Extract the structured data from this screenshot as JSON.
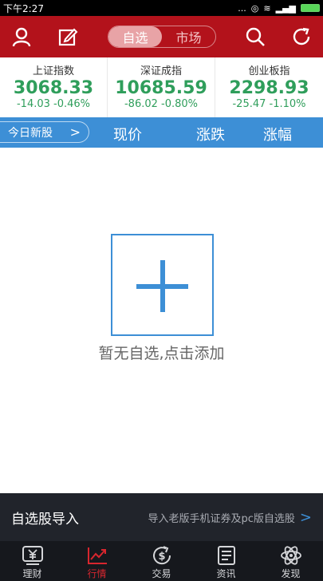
{
  "status": {
    "time": "下午2:27",
    "dots": "..."
  },
  "header": {
    "seg_active": "自选",
    "seg_inactive": "市场"
  },
  "indices": [
    {
      "name": "上证指数",
      "value": "3068.33",
      "change": "-14.03 -0.46%"
    },
    {
      "name": "深证成指",
      "value": "10685.59",
      "change": "-86.02 -0.80%"
    },
    {
      "name": "创业板指",
      "value": "2298.93",
      "change": "-25.47 -1.10%"
    }
  ],
  "columns": {
    "new_stock": "今日新股",
    "price": "现价",
    "change": "涨跌",
    "pct": "涨幅"
  },
  "empty": {
    "message": "暂无自选,点击添加"
  },
  "import": {
    "title": "自选股导入",
    "desc": "导入老版手机证券及pc版自选股"
  },
  "tabs": [
    {
      "label": "理财",
      "icon": "yuan-icon"
    },
    {
      "label": "行情",
      "icon": "chart-icon"
    },
    {
      "label": "交易",
      "icon": "dollar-exchange-icon"
    },
    {
      "label": "资讯",
      "icon": "news-icon"
    },
    {
      "label": "发现",
      "icon": "atom-icon"
    }
  ],
  "colors": {
    "header": "#b3121b",
    "accent": "#3d8fd6",
    "down": "#2f9e5b",
    "tab_active": "#d8262e"
  }
}
